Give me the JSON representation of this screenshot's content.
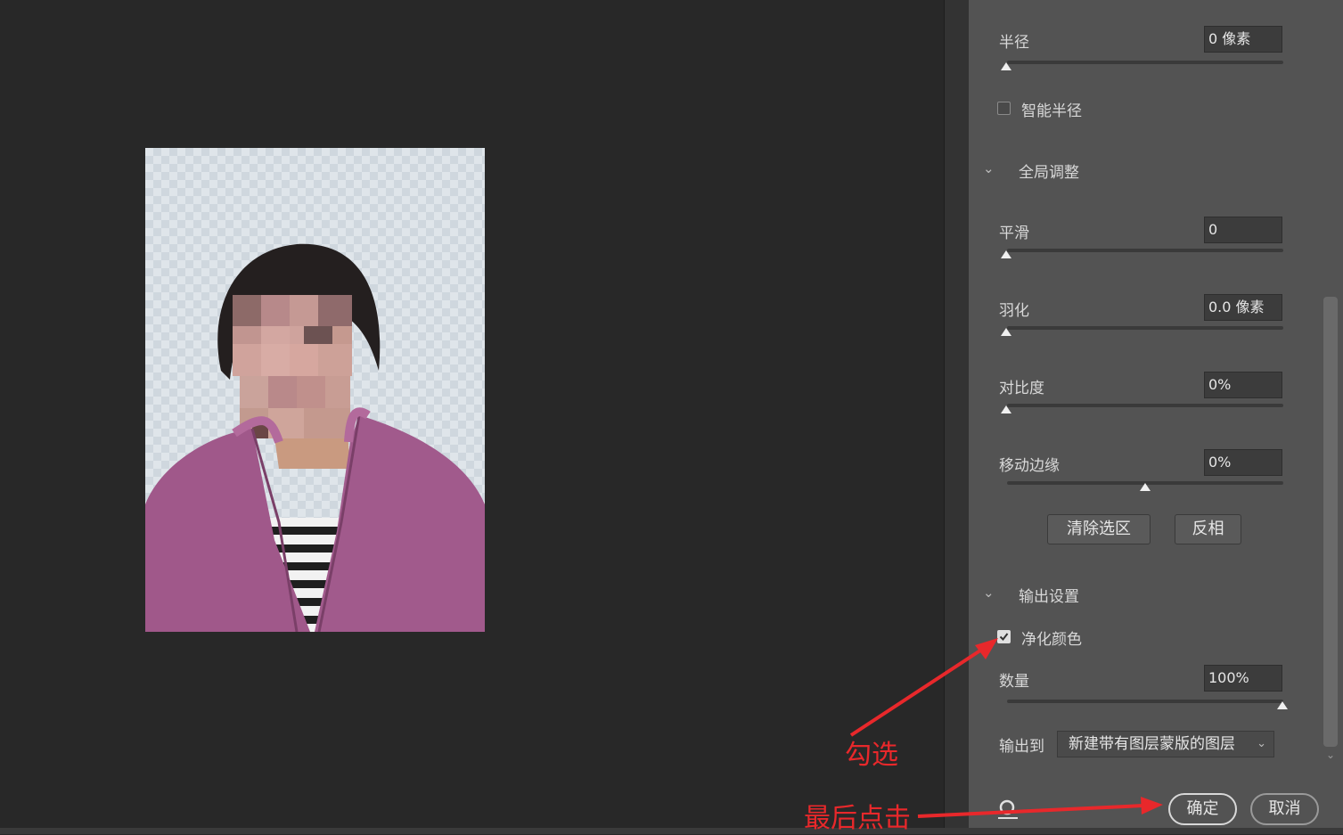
{
  "panel": {
    "radius": {
      "label": "半径",
      "value": "0 像素",
      "slider": 0
    },
    "smart_radius": {
      "label": "智能半径",
      "checked": false
    },
    "global_adjust": {
      "title": "全局调整",
      "smooth": {
        "label": "平滑",
        "value": "0",
        "slider": 0
      },
      "feather": {
        "label": "羽化",
        "value": "0.0 像素",
        "slider": 0
      },
      "contrast": {
        "label": "对比度",
        "value": "0%",
        "slider": 0
      },
      "shift_edge": {
        "label": "移动边缘",
        "value": "0%",
        "slider": 0.5
      },
      "clear_selection_label": "清除选区",
      "invert_label": "反相"
    },
    "output": {
      "title": "输出设置",
      "decontaminate": {
        "label": "净化颜色",
        "checked": true
      },
      "amount": {
        "label": "数量",
        "value": "100%",
        "slider": 1
      },
      "output_to_label": "输出到",
      "output_to_value": "新建带有图层蒙版的图层"
    },
    "ok_label": "确定",
    "cancel_label": "取消"
  },
  "annotations": {
    "check_hint": "勾选",
    "final_click_hint": "最后点击"
  },
  "colors": {
    "panel_bg": "#535353",
    "canvas_bg": "#282828",
    "annotation_red": "#e8282b"
  },
  "icons": {
    "section_toggle": "chevron-down-icon",
    "slider_thumb": "triangle-up-icon",
    "select_caret": "chevron-down-icon"
  }
}
